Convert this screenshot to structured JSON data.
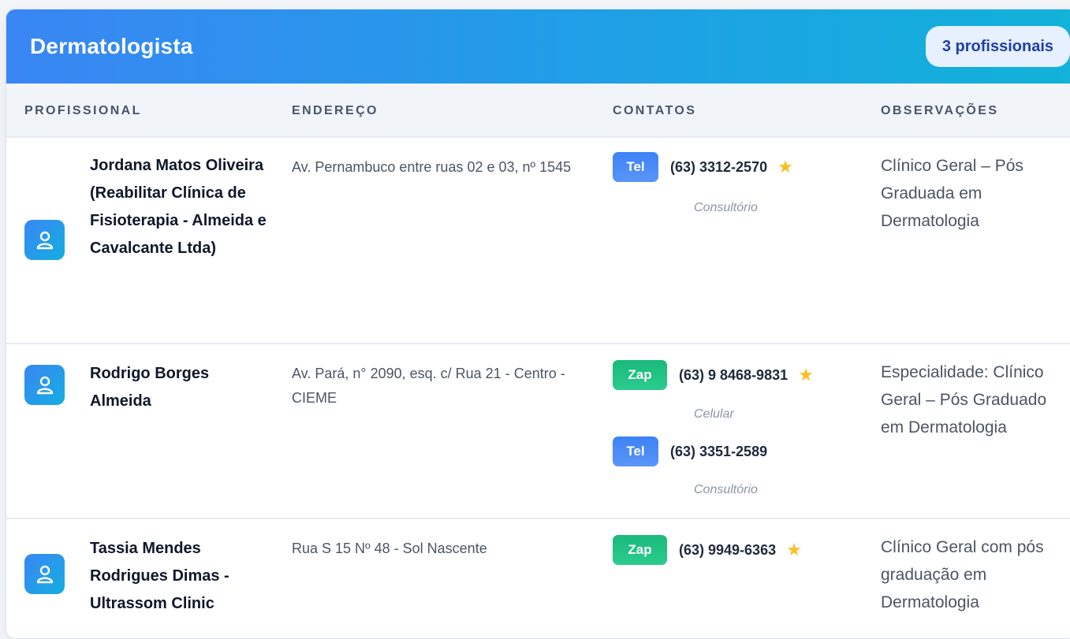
{
  "header": {
    "title": "Dermatologista",
    "count": "3 profissionais"
  },
  "columns": [
    "PROFISSIONAL",
    "ENDEREÇO",
    "CONTATOS",
    "OBSERVAÇÕES"
  ],
  "rows": [
    {
      "name": "Jordana Matos Oliveira (Reabilitar Clínica de Fisioterapia - Almeida e Cavalcante Ltda)",
      "address": "Av. Pernambuco entre ruas 02 e 03, nº 1545",
      "contacts": [
        {
          "type": "Tel",
          "number": "(63) 3312-2570",
          "star": "★",
          "label": "Consultório"
        }
      ],
      "obs": "Clínico Geral – Pós Graduada em Dermatologia"
    },
    {
      "name": "Rodrigo Borges Almeida",
      "address": "Av. Pará, n° 2090, esq. c/ Rua 21 - Centro - CIEME",
      "contacts": [
        {
          "type": "Zap",
          "number": "(63) 9 8468-9831",
          "star": "★",
          "label": "Celular"
        },
        {
          "type": "Tel",
          "number": "(63) 3351-2589",
          "label": "Consultório"
        }
      ],
      "obs": "Especialidade: Clínico Geral – Pós Graduado em Dermatologia"
    },
    {
      "name": "Tassia Mendes Rodrigues Dimas - Ultrassom Clinic",
      "address": "Rua S 15 Nº 48 - Sol Nascente",
      "contacts": [
        {
          "type": "Zap",
          "number": "(63) 9949-6363",
          "star": "★"
        }
      ],
      "obs": "Clínico Geral com pós graduação em Dermatologia"
    }
  ],
  "icons": {
    "avatar": "person-icon",
    "star": "star-icon"
  },
  "colors": {
    "header_start": "#3a86f4",
    "header_end": "#12b2d9",
    "tel_badge": "#3c82f6",
    "zap_badge": "#19b87b",
    "star": "#fbbf24",
    "count_badge_text": "#1f40a6"
  }
}
